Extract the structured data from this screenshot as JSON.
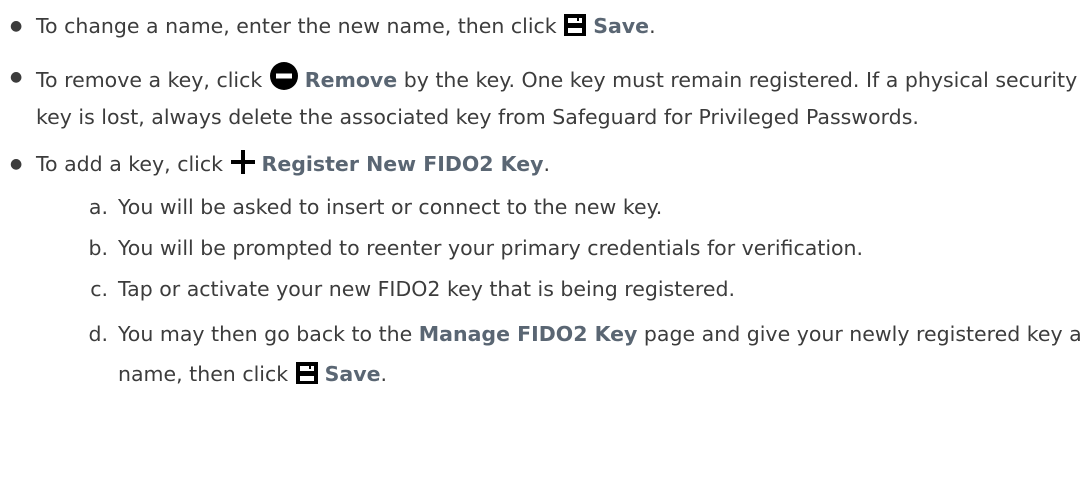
{
  "bullets": [
    {
      "before": "To change a name, enter the new name, then click ",
      "label": "Save",
      "after": ".",
      "icon": "save-icon"
    },
    {
      "before": "To remove a key, click ",
      "label": "Remove",
      "after": " by the key. One key must remain registered. If a physical security key is lost, always delete the associated key from Safeguard for Privileged Passwords.",
      "icon": "remove-icon"
    },
    {
      "before": "To add a key, click ",
      "label": "Register New FIDO2 Key",
      "after": ".",
      "icon": "plus-icon"
    }
  ],
  "steps": [
    {
      "letter": "a.",
      "text": "You will be asked to insert or connect to the new key."
    },
    {
      "letter": "b.",
      "text": "You will be prompted to reenter your primary credentials for verification."
    },
    {
      "letter": "c.",
      "text": "Tap or activate your new FIDO2 key that is being registered."
    },
    {
      "letter": "d.",
      "before": "You may then go back to the ",
      "page_label": "Manage FIDO2 Key",
      "middle": " page and give your newly registered key a name, then click ",
      "save_label": "Save",
      "after": "."
    }
  ],
  "colors": {
    "text": "#3c3c3c",
    "strong_label": "#5a6673",
    "icon": "#000000"
  }
}
